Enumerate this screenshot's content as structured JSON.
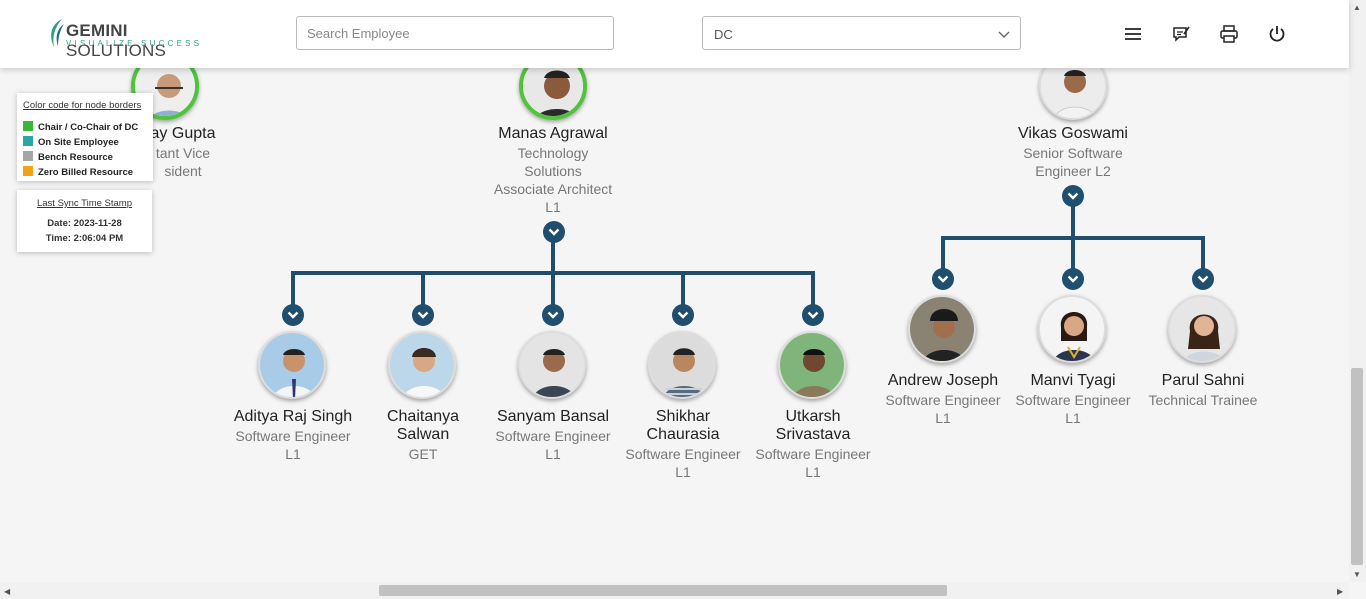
{
  "header": {
    "logo_name_bold": "GEMINI",
    "logo_name_rest": " SOLUTIONS",
    "logo_tagline": "VISUALIZE SUCCESS",
    "search_placeholder": "Search Employee",
    "dc_selected": "DC",
    "icons": [
      "menu-icon",
      "feedback-icon",
      "print-icon",
      "power-icon"
    ]
  },
  "legend": {
    "title": "Color code for node borders",
    "items": [
      {
        "label": "Chair / Co-Chair of DC",
        "color": "#3bb83b"
      },
      {
        "label": "On Site Employee",
        "color": "#2aa7a0"
      },
      {
        "label": "Bench Resource",
        "color": "#a6a6a6"
      },
      {
        "label": "Zero Billed Resource",
        "color": "#f2a313"
      }
    ]
  },
  "sync": {
    "title": "Last Sync Time Stamp",
    "date": "Date: 2023-11-28",
    "time": "Time: 2:06:04 PM"
  },
  "top_nodes": [
    {
      "name": "ay Gupta",
      "role_lines": [
        "tant Vice",
        "sident"
      ]
    },
    {
      "name": "Manas Agrawal",
      "role_lines": [
        "Technology",
        "Solutions",
        "Associate Architect",
        "L1"
      ]
    },
    {
      "name": "Vikas Goswami",
      "role_lines": [
        "Senior Software",
        "Engineer L2"
      ]
    }
  ],
  "manas_team": [
    {
      "name_lines": [
        "Aditya Raj Singh"
      ],
      "role_lines": [
        "Software Engineer",
        "L1"
      ]
    },
    {
      "name_lines": [
        "Chaitanya",
        "Salwan"
      ],
      "role_lines": [
        "GET"
      ]
    },
    {
      "name_lines": [
        "Sanyam Bansal"
      ],
      "role_lines": [
        "Software Engineer",
        "L1"
      ]
    },
    {
      "name_lines": [
        "Shikhar",
        "Chaurasia"
      ],
      "role_lines": [
        "Software Engineer",
        "L1"
      ]
    },
    {
      "name_lines": [
        "Utkarsh",
        "Srivastava"
      ],
      "role_lines": [
        "Software Engineer",
        "L1"
      ]
    }
  ],
  "vikas_team": [
    {
      "name_lines": [
        "Andrew Joseph"
      ],
      "role_lines": [
        "Software Engineer",
        "L1"
      ]
    },
    {
      "name_lines": [
        "Manvi Tyagi"
      ],
      "role_lines": [
        "Software Engineer",
        "L1"
      ]
    },
    {
      "name_lines": [
        "Parul Sahni"
      ],
      "role_lines": [
        "Technical Trainee"
      ]
    }
  ]
}
